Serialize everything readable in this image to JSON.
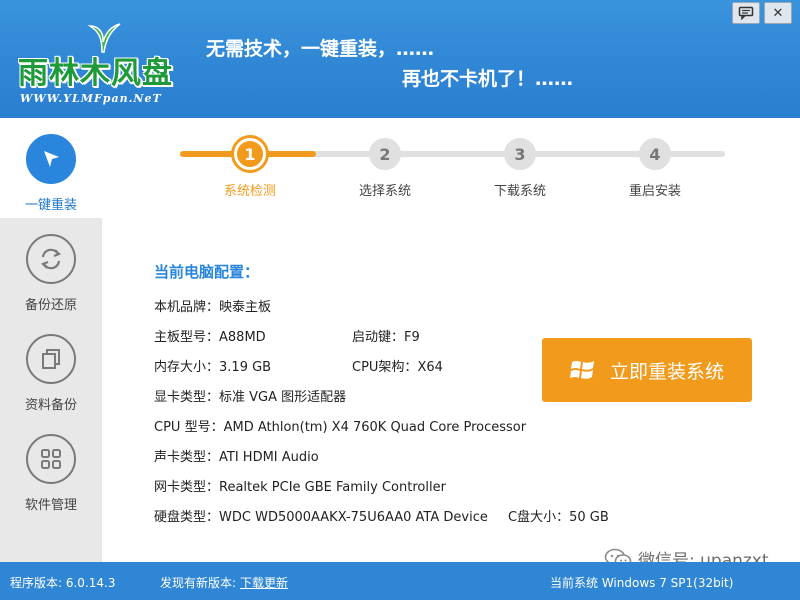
{
  "header": {
    "logo_text": "雨林木风盘",
    "logo_url": "WWW.YLMFpan.NeT",
    "slogan_line1": "无需技术，一键重装，……",
    "slogan_line2": "再也不卡机了！……",
    "window_buttons": [
      {
        "name": "feedback-icon"
      },
      {
        "name": "close-icon",
        "label": "✕"
      }
    ]
  },
  "sidebar": {
    "items": [
      {
        "label": "一键重装",
        "icon": "cursor-icon",
        "active": true
      },
      {
        "label": "备份还原",
        "icon": "refresh-icon",
        "active": false
      },
      {
        "label": "资料备份",
        "icon": "copy-icon",
        "active": false
      },
      {
        "label": "软件管理",
        "icon": "grid-icon",
        "active": false
      }
    ]
  },
  "steps": {
    "progress_fraction": 0.25,
    "items": [
      {
        "num": "1",
        "label": "系统检测",
        "done": true
      },
      {
        "num": "2",
        "label": "选择系统",
        "done": false
      },
      {
        "num": "3",
        "label": "下载系统",
        "done": false
      },
      {
        "num": "4",
        "label": "重启安装",
        "done": false
      }
    ]
  },
  "config": {
    "title": "当前电脑配置：",
    "brand": {
      "key": "本机品牌：",
      "value": "映泰主板"
    },
    "board": {
      "key": "主板型号：",
      "value": "A88MD"
    },
    "bootkey": {
      "key": "启动键：",
      "value": "F9"
    },
    "memory": {
      "key": "内存大小：",
      "value": "3.19 GB"
    },
    "cpu_arch": {
      "key": "CPU架构：",
      "value": "X64"
    },
    "gpu": {
      "key": "显卡类型：",
      "value": "标准 VGA 图形适配器"
    },
    "cpu": {
      "key": "CPU 型号：",
      "value": "AMD Athlon(tm) X4 760K Quad Core Processor"
    },
    "sound": {
      "key": "声卡类型：",
      "value": "ATI HDMI Audio"
    },
    "network": {
      "key": "网卡类型：",
      "value": "Realtek PCIe GBE Family Controller"
    },
    "disk": {
      "key": "硬盘类型：",
      "value": "WDC WD5000AAKX-75U6AA0 ATA Device"
    },
    "disk_c": {
      "key": "C盘大小：",
      "value": "50 GB"
    }
  },
  "action": {
    "reinstall_label": "立即重装系统",
    "icon": "windows-logo-icon"
  },
  "watermark": {
    "text": "微信号: upanzxt",
    "icon": "wechat-icon"
  },
  "status": {
    "version": "程序版本: 6.0.14.3",
    "new_version_prefix": "发现有新版本:",
    "download_link": "下载更新",
    "current_system": "当前系统 Windows 7 SP1(32bit)"
  },
  "colors": {
    "header_blue": "#2f86d4",
    "accent_orange": "#f29a1b",
    "title_blue": "#2a86dc",
    "logo_green": "#1f9a3a"
  }
}
